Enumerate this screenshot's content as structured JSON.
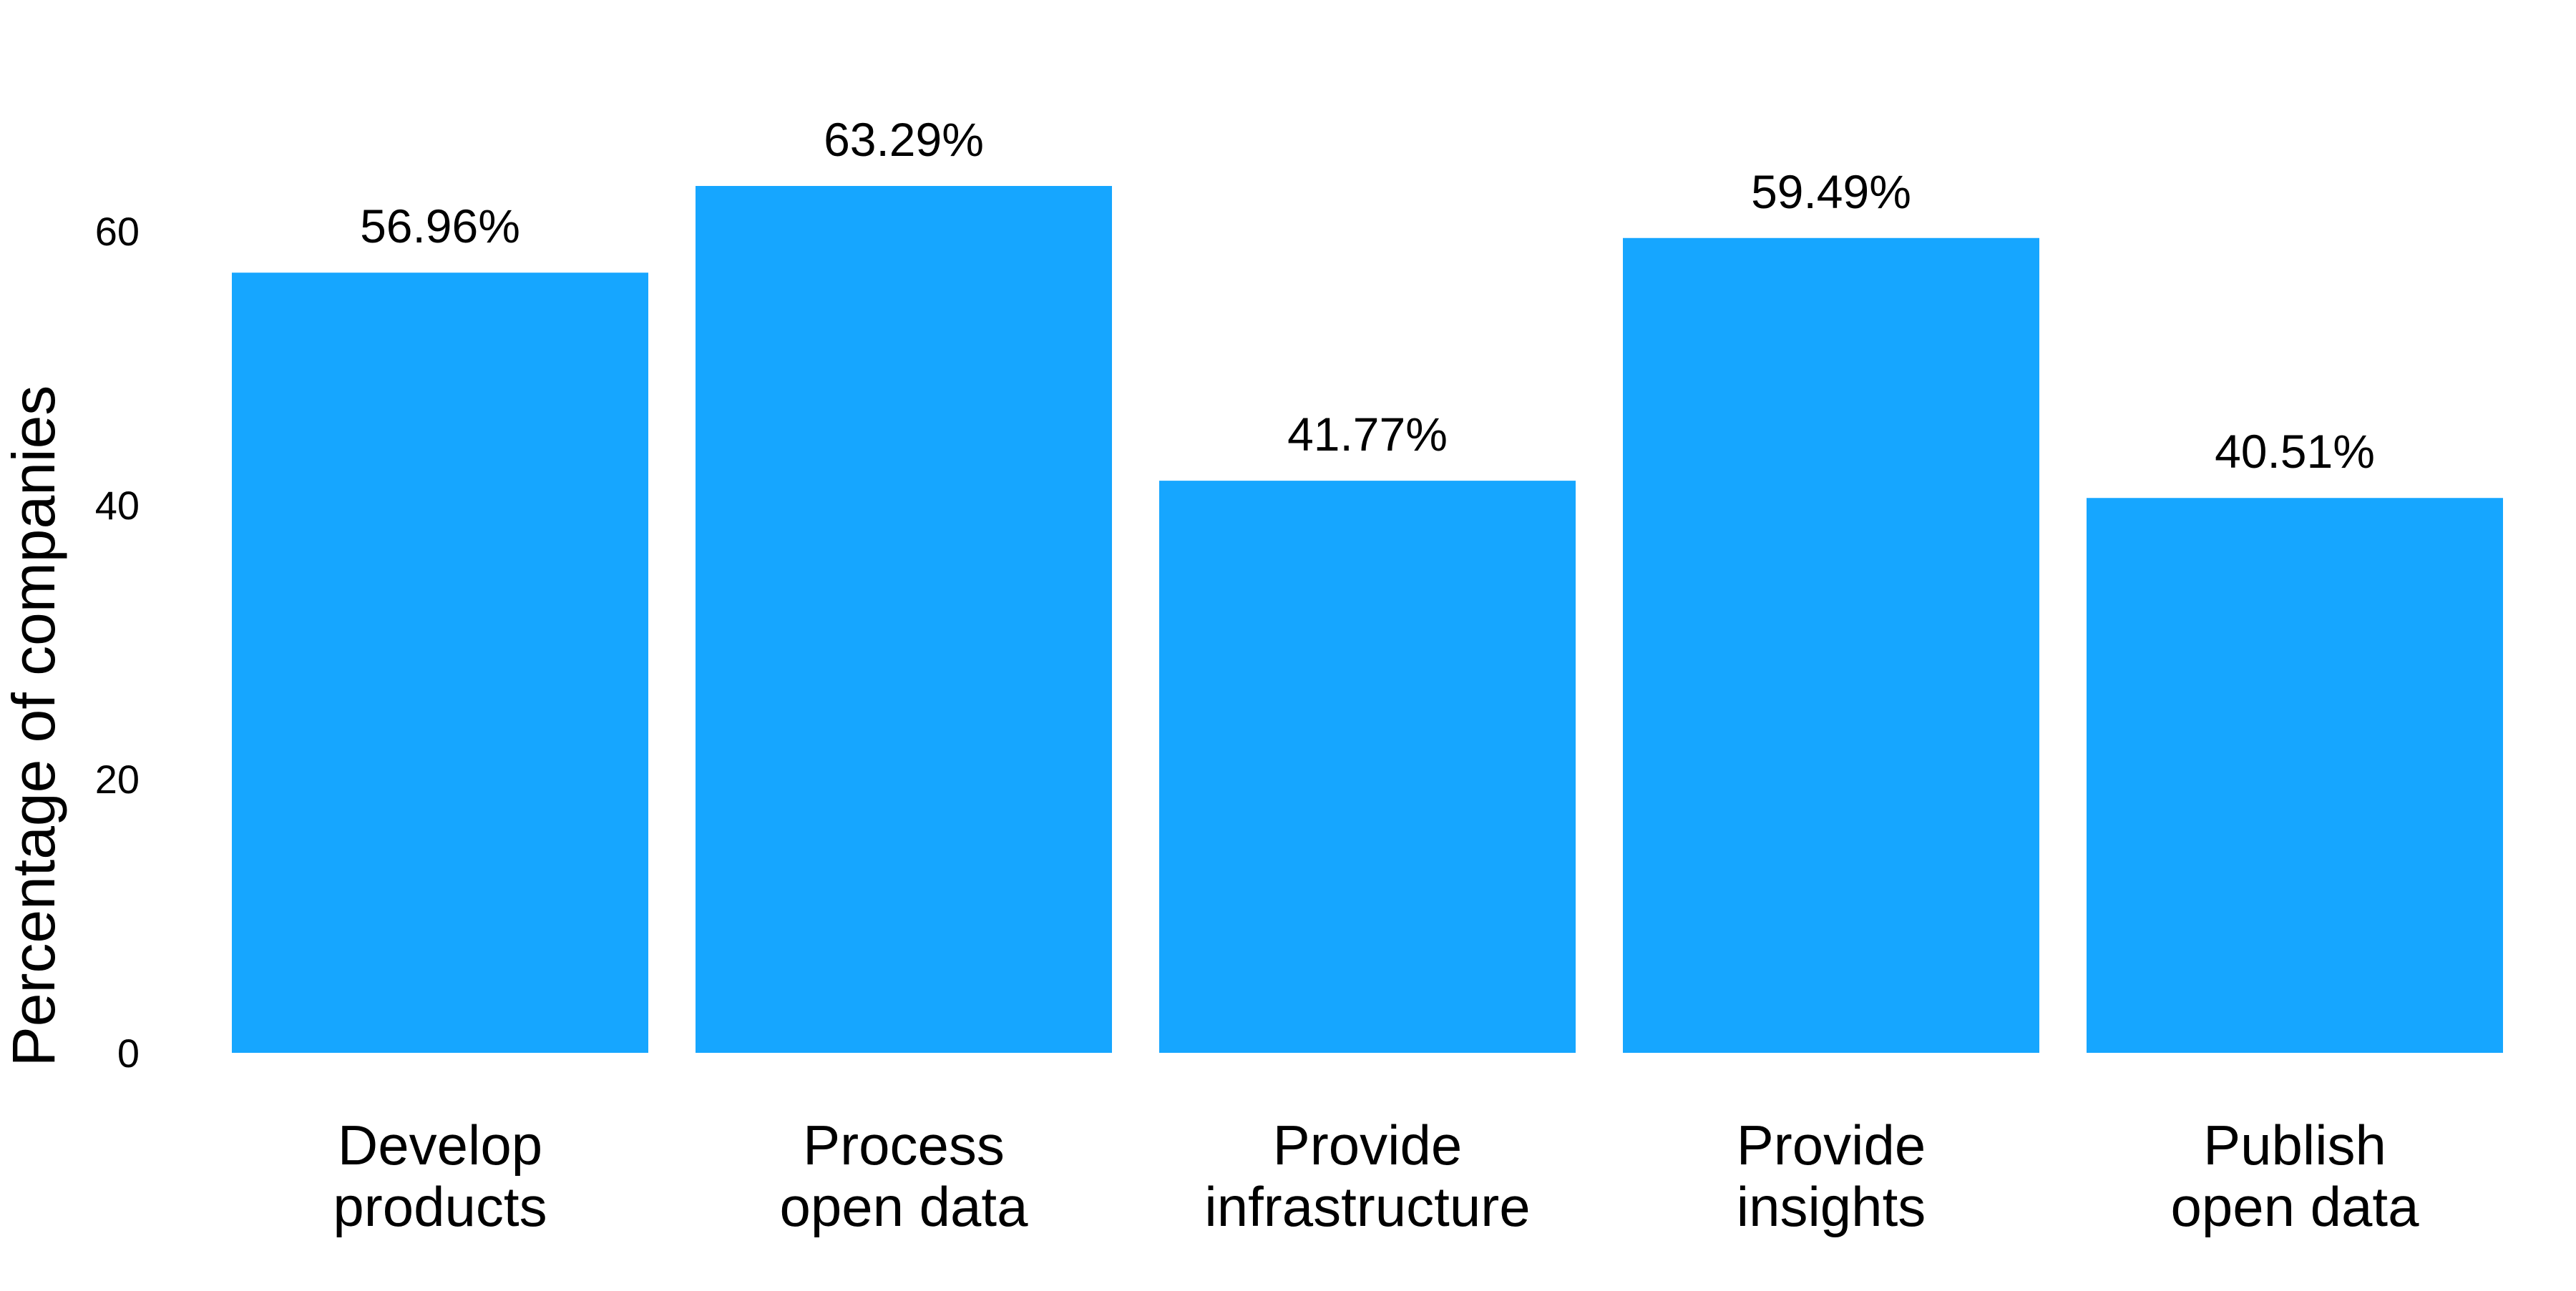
{
  "chart_data": {
    "type": "bar",
    "title": "",
    "xlabel": "",
    "ylabel": "Percentage of companies",
    "ylim": [
      0,
      70
    ],
    "yticks": [
      0,
      20,
      40,
      60
    ],
    "grid": false,
    "categories": [
      [
        "Develop",
        "products"
      ],
      [
        "Process",
        "open data"
      ],
      [
        "Provide",
        "infrastructure"
      ],
      [
        "Provide",
        "insights"
      ],
      [
        "Publish",
        "open data"
      ]
    ],
    "values": [
      56.96,
      63.29,
      41.77,
      59.49,
      40.51
    ],
    "value_labels": [
      "56.96%",
      "63.29%",
      "41.77%",
      "59.49%",
      "40.51%"
    ],
    "bar_color": "#16a6ff"
  }
}
